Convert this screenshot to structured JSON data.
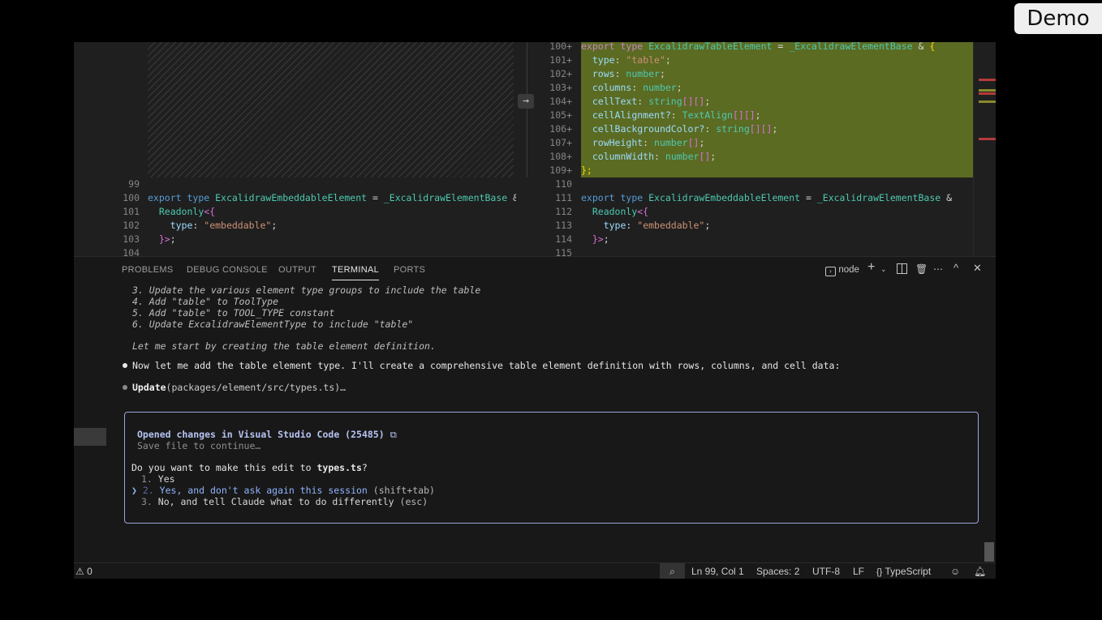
{
  "badge": "Demo",
  "diff_left": {
    "lines": [
      {
        "n": "99",
        "kind": "blank"
      },
      {
        "n": "100",
        "kind": "export",
        "a": "export",
        "b": "type",
        "c": "ExcalidrawEmbeddableElement",
        "d": " = ",
        "e": "_ExcalidrawElementBase",
        "f": " &"
      },
      {
        "n": "101",
        "kind": "readonly",
        "a": "Readonly",
        "b": "<{"
      },
      {
        "n": "102",
        "kind": "prop",
        "a": "type",
        "b": ": ",
        "c": "\"embeddable\"",
        "d": ";"
      },
      {
        "n": "103",
        "kind": "close",
        "a": "}>",
        "b": ";"
      },
      {
        "n": "104",
        "kind": "blank"
      }
    ]
  },
  "diff_right": {
    "added": [
      {
        "n": "100+",
        "a": "export",
        "b": "type",
        "c": "ExcalidrawTableElement",
        "d": " = ",
        "e": "_ExcalidrawElementBase",
        "f": " & ",
        "g": "{"
      },
      {
        "n": "101+",
        "p": "type",
        "v": "\"table\"",
        "vt": "st",
        "s": ";"
      },
      {
        "n": "102+",
        "p": "rows",
        "v": "number",
        "vt": "ty",
        "s": ";"
      },
      {
        "n": "103+",
        "p": "columns",
        "v": "number",
        "vt": "ty",
        "s": ";"
      },
      {
        "n": "104+",
        "p": "cellText",
        "v": "string",
        "vt": "ty",
        "x": "[][]",
        "s": ";"
      },
      {
        "n": "105+",
        "p": "cellAlignment?",
        "v": "TextAlign",
        "vt": "ty",
        "x": "[][]",
        "s": ";"
      },
      {
        "n": "106+",
        "p": "cellBackgroundColor?",
        "v": "string",
        "vt": "ty",
        "x": "[][]",
        "s": ";"
      },
      {
        "n": "107+",
        "p": "rowHeight",
        "v": "number",
        "vt": "ty",
        "x": "[]",
        "s": ";"
      },
      {
        "n": "108+",
        "p": "columnWidth",
        "v": "number",
        "vt": "ty",
        "x": "[]",
        "s": ";"
      },
      {
        "n": "109+",
        "close": "};"
      }
    ],
    "lines": [
      {
        "n": "110",
        "kind": "blank"
      },
      {
        "n": "111",
        "kind": "export",
        "a": "export",
        "b": "type",
        "c": "ExcalidrawEmbeddableElement",
        "d": " = ",
        "e": "_ExcalidrawElementBase",
        "f": " &"
      },
      {
        "n": "112",
        "kind": "readonly",
        "a": "Readonly",
        "b": "<{"
      },
      {
        "n": "113",
        "kind": "prop",
        "a": "type",
        "b": ": ",
        "c": "\"embeddable\"",
        "d": ";"
      },
      {
        "n": "114",
        "kind": "close",
        "a": "}>",
        "b": ";"
      },
      {
        "n": "115",
        "kind": "blank"
      }
    ]
  },
  "panel": {
    "tabs": [
      "PROBLEMS",
      "DEBUG CONSOLE",
      "OUTPUT",
      "TERMINAL",
      "PORTS"
    ],
    "terminal_name": "node"
  },
  "terminal": {
    "steps": [
      "3. Update the various element type groups to include the table",
      "4. Add \"table\" to ToolType",
      "5. Add \"table\" to TOOL_TYPE constant",
      "6. Update ExcalidrawElementType to include \"table\""
    ],
    "start_text": "Let me start by creating the table element definition.",
    "message": "Now let me add the table element type. I'll create a comprehensive table element definition with rows, columns, and cell data:",
    "update_label": "Update",
    "update_path": "(packages/element/src/types.ts)…"
  },
  "dialog": {
    "title": "Opened changes in Visual Studio Code (25485)",
    "copy_icon": "⧉",
    "subtitle": "Save file to continue…",
    "question_prefix": "Do you want to make this edit to ",
    "question_file": "types.ts",
    "question_suffix": "?",
    "options": [
      {
        "num": "1.",
        "label": "Yes"
      },
      {
        "num": "2.",
        "label": "Yes, and don't ask again this session",
        "hint": "(shift+tab)"
      },
      {
        "num": "3.",
        "label": "No, and tell Claude what to do differently",
        "hint": "(esc)"
      }
    ],
    "selected_marker": "❯"
  },
  "status": {
    "problems_count": "0",
    "cursor": "Ln 99, Col 1",
    "spaces": "Spaces: 2",
    "encoding": "UTF-8",
    "eol": "LF",
    "language": "TypeScript"
  }
}
